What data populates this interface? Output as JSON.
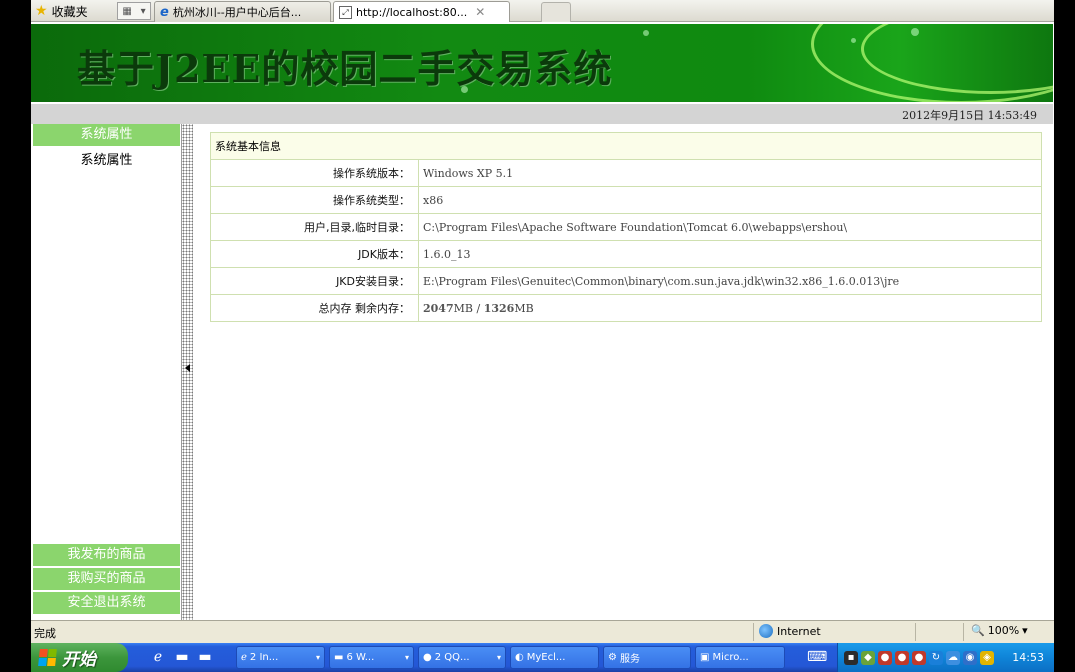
{
  "browser": {
    "favorites_label": "收藏夹",
    "tabs": [
      {
        "label": "杭州冰川--用户中心后台..."
      },
      {
        "label": "http://localhost:80..."
      }
    ]
  },
  "page": {
    "banner_title": "基于J2EE的校园二手交易系统",
    "datetime": "2012年9月15日  14:53:49"
  },
  "sidebar": {
    "header": "系统属性",
    "sub_item": "系统属性",
    "footer_items": [
      {
        "label": "我发布的商品"
      },
      {
        "label": "我购买的商品"
      },
      {
        "label": "安全退出系统"
      }
    ]
  },
  "info": {
    "caption": "系统基本信息",
    "rows": [
      {
        "label": "操作系统版本：",
        "value": "Windows XP  5.1"
      },
      {
        "label": "操作系统类型：",
        "value": "x86"
      },
      {
        "label": "用户,目录,临时目录：",
        "value": "C:\\Program Files\\Apache Software Foundation\\Tomcat 6.0\\webapps\\ershou\\"
      },
      {
        "label": "JDK版本：",
        "value": "1.6.0_13"
      },
      {
        "label": "JKD安装目录：",
        "value": "E:\\Program Files\\Genuitec\\Common\\binary\\com.sun.java.jdk\\win32.x86_1.6.0.013\\jre"
      },
      {
        "label": "总内存 剩余内存：",
        "mem_total": "2047",
        "mem_free": "1326",
        "unit": "MB",
        "sep": " / "
      }
    ]
  },
  "statusbar": {
    "status": "完成",
    "zone": "Internet",
    "zoom": "100%"
  },
  "taskbar": {
    "start_label": "开始",
    "tasks": [
      {
        "label": "2 In..."
      },
      {
        "label": "6 W..."
      },
      {
        "label": "2 QQ..."
      },
      {
        "label": "MyEcl..."
      },
      {
        "label": "服务"
      },
      {
        "label": "Micro..."
      }
    ],
    "clock": "14:53"
  }
}
